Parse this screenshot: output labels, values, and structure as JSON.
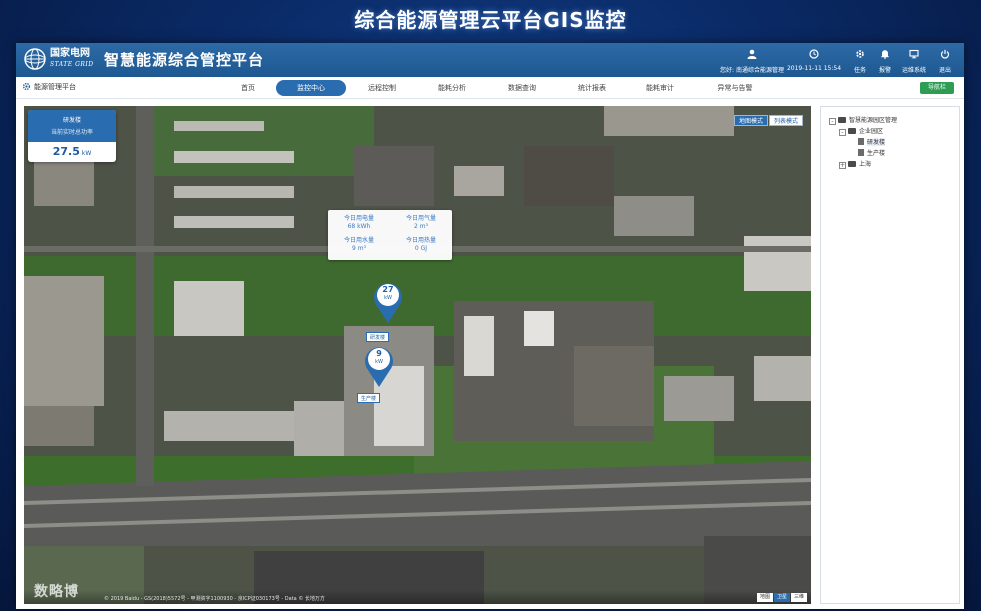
{
  "slide": {
    "title": "综合能源管理云平台GIS监控"
  },
  "header": {
    "logo_cn": "国家电网",
    "logo_en": "STATE GRID",
    "app_title": "智慧能源综合管控平台",
    "user_text": "您好: 南通综合能源管理",
    "datetime": "2019-11-11 15:54",
    "buttons": [
      {
        "label": "任务",
        "icon": "task-icon"
      },
      {
        "label": "报警",
        "icon": "bell-icon"
      },
      {
        "label": "运维系统",
        "icon": "monitor-icon"
      },
      {
        "label": "退出",
        "icon": "power-icon"
      }
    ]
  },
  "nav": {
    "crumb": "能源管理平台",
    "tabs": [
      {
        "label": "首页",
        "active": false
      },
      {
        "label": "监控中心",
        "active": true
      },
      {
        "label": "远程控制",
        "active": false
      },
      {
        "label": "能耗分析",
        "active": false
      },
      {
        "label": "数据查询",
        "active": false
      },
      {
        "label": "统计报表",
        "active": false
      },
      {
        "label": "能耗审计",
        "active": false
      },
      {
        "label": "异常与告警",
        "active": false
      }
    ],
    "right_button": "导航栏"
  },
  "map": {
    "stat_card": {
      "name": "研发楼",
      "subtitle": "当前实时总功率",
      "value": "27.5",
      "unit": "kW"
    },
    "mode_buttons": [
      {
        "label": "地图模式",
        "active": true
      },
      {
        "label": "列表模式",
        "active": false
      }
    ],
    "popup": {
      "cells": [
        {
          "label": "今日用电量",
          "value": "68 kWh"
        },
        {
          "label": "今日用气量",
          "value": "2 m³"
        },
        {
          "label": "今日用水量",
          "value": "9 m³"
        },
        {
          "label": "今日用热量",
          "value": "0 GJ"
        }
      ]
    },
    "markers": [
      {
        "value": "27",
        "unit": "kW",
        "label": "研发楼"
      },
      {
        "value": "9",
        "unit": "kW",
        "label": "生产楼"
      }
    ],
    "copyright": "© 2019 Baidu - GS(2018)5572号 - 甲测资字1100930 - 京ICP证030173号 - Data © 长地万方",
    "map_types": [
      {
        "label": "地图",
        "active": false
      },
      {
        "label": "卫星",
        "active": true
      },
      {
        "label": "三维",
        "active": false
      }
    ],
    "watermark": "数略博"
  },
  "tree": {
    "nodes": [
      {
        "label": "智慧能源园区管理",
        "level": 0,
        "toggle": "-",
        "kind": "folder"
      },
      {
        "label": "企业园区",
        "level": 1,
        "toggle": "-",
        "kind": "folder"
      },
      {
        "label": "研发楼",
        "level": 2,
        "toggle": "",
        "kind": "doc",
        "selected": true
      },
      {
        "label": "生产楼",
        "level": 2,
        "toggle": "",
        "kind": "doc"
      },
      {
        "label": "上海",
        "level": 1,
        "toggle": "+",
        "kind": "folder"
      }
    ]
  },
  "colors": {
    "brand_blue": "#2a6cb0",
    "header_blue": "#1d5891",
    "accent_green": "#2e9d54"
  }
}
